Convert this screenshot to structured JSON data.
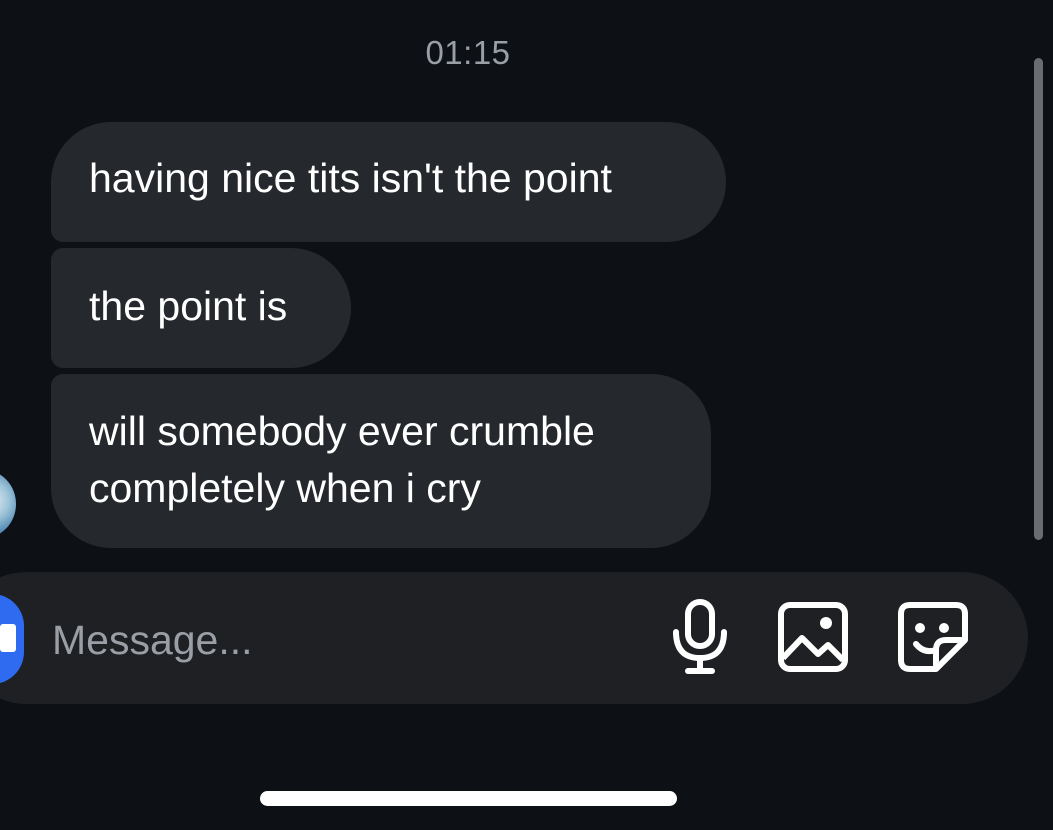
{
  "thread": {
    "timestamp": "01:15",
    "messages": [
      {
        "lines": [
          "having nice tits isn't the point"
        ]
      },
      {
        "lines": [
          "the point is"
        ]
      },
      {
        "lines": [
          "will somebody ever crumble",
          "completely when i cry"
        ]
      }
    ]
  },
  "composer": {
    "placeholder": "Message...",
    "value": "",
    "icons": [
      "camera-icon",
      "microphone-icon",
      "image-icon",
      "sticker-icon"
    ]
  },
  "colors": {
    "background": "#0d1014",
    "bubble": "#25282d",
    "composer": "#1e2024",
    "camera_button": "#2f6bf0",
    "timestamp_text": "#9a9ea5"
  }
}
